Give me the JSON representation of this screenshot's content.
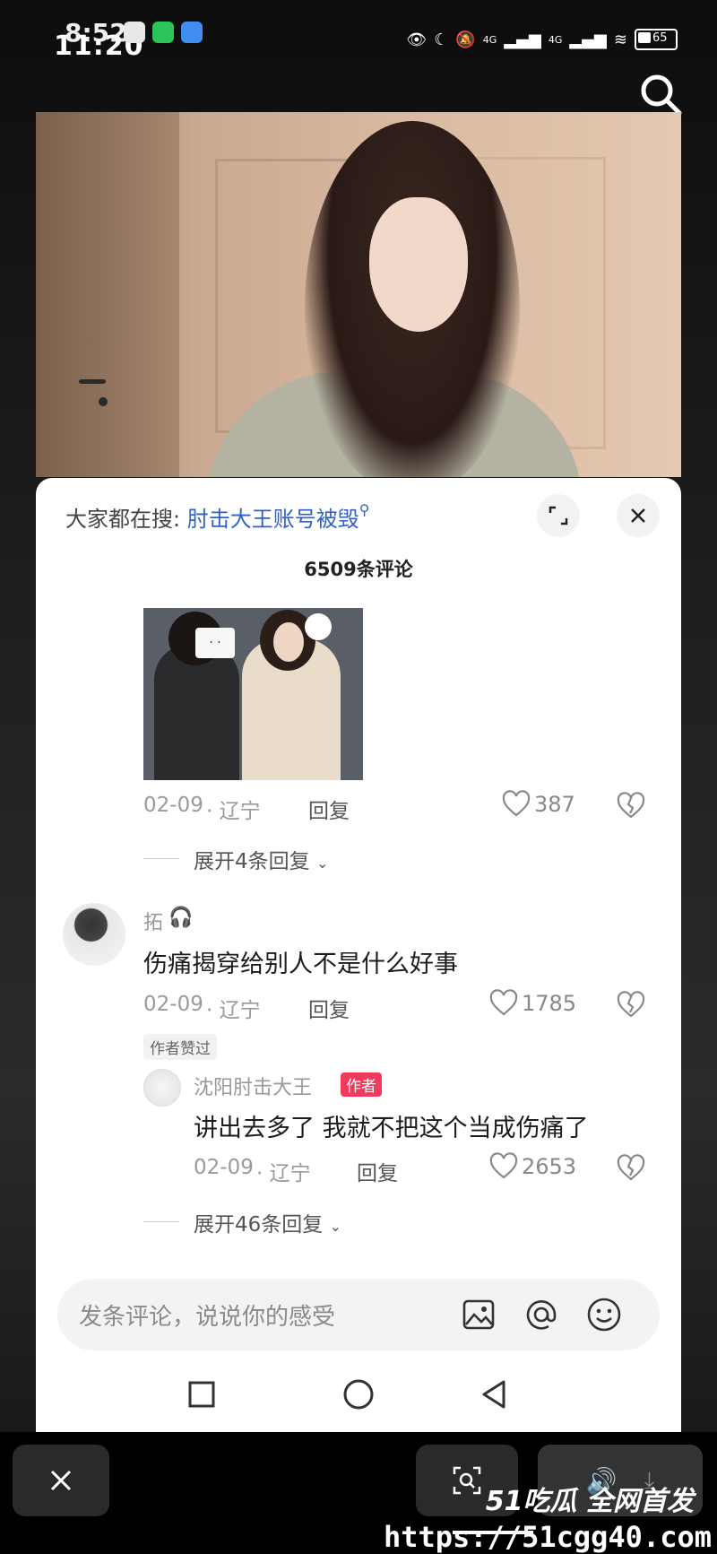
{
  "status": {
    "time_a": "8:52",
    "time_b": "11:20",
    "network_a": "4G",
    "network_b": "4G",
    "battery": "65"
  },
  "sheet": {
    "hot_prefix": "大家都在搜:",
    "hot_query": "肘击大王账号被毁",
    "comment_count": "6509条评论"
  },
  "comments": {
    "first": {
      "date": "02-09",
      "location": "· 辽宁",
      "reply": "回复",
      "likes": "387",
      "expand": "展开4条回复"
    },
    "second": {
      "username": "拓",
      "text": "伤痛揭穿给别人不是什么好事",
      "date": "02-09",
      "location": "· 辽宁",
      "reply": "回复",
      "likes": "1785",
      "author_liked": "作者赞过"
    },
    "reply": {
      "username": "沈阳肘击大王",
      "author_tag": "作者",
      "text": "讲出去多了 我就不把这个当成伤痛了",
      "date": "02-09",
      "location": "· 辽宁",
      "reply": "回复",
      "likes": "2653",
      "expand": "展开46条回复"
    },
    "image_mask_text": "· ·"
  },
  "input": {
    "placeholder": "发条评论，说说你的感受"
  },
  "watermark": {
    "brand": "51吃瓜 全网首发",
    "url": "https://51cgg40.com"
  },
  "colors": {
    "link": "#2f62c7",
    "author_tag": "#ef3b5c"
  }
}
